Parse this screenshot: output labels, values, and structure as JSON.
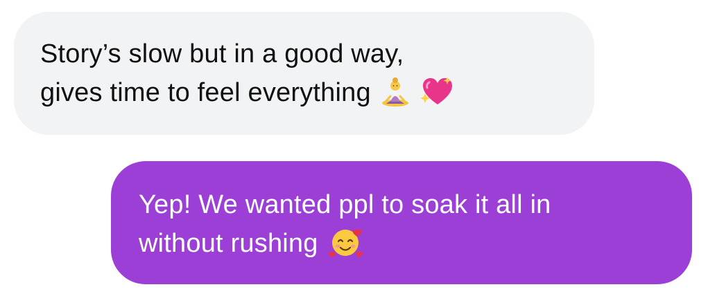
{
  "conversation": {
    "messages": [
      {
        "direction": "received",
        "lines": [
          "Story’s slow but in a good way,",
          "gives time to feel everything"
        ],
        "emojis": [
          "woman-in-lotus-position-icon",
          "sparkling-heart-icon"
        ]
      },
      {
        "direction": "sent",
        "lines": [
          "Yep! We wanted ppl to soak it all in",
          "without rushing"
        ],
        "emojis": [
          "smiling-face-with-hearts-icon"
        ]
      }
    ]
  },
  "colors": {
    "received_bubble": "#f2f3f5",
    "received_text": "#111111",
    "sent_bubble": "#9b3fd6",
    "sent_text": "#ffffff"
  }
}
